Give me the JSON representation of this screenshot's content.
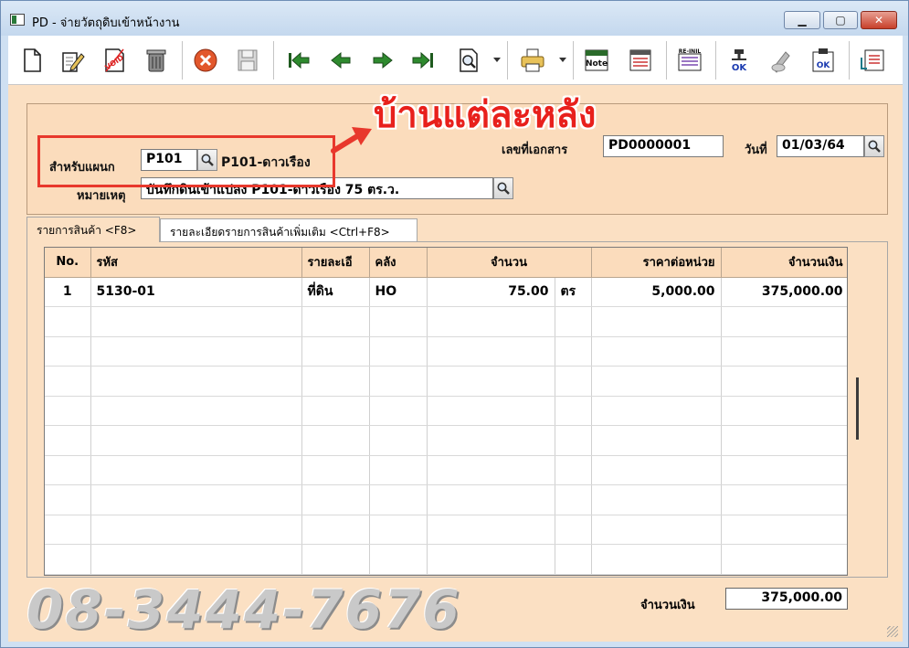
{
  "window": {
    "title": "PD - จ่ายวัตถุดิบเข้าหน้างาน",
    "min_glyph": "▁",
    "max_glyph": "▢",
    "close_glyph": "✕"
  },
  "toolbar": {
    "items": [
      "new-document-icon",
      "edit-icon",
      "void-icon",
      "delete-icon",
      "cancel-icon",
      "save-icon",
      "first-record-icon",
      "previous-record-icon",
      "next-record-icon",
      "last-record-icon",
      "find-icon",
      "print-icon",
      "note-icon",
      "form-icon",
      "recalc-icon",
      "approve-icon",
      "unapprove-icon",
      "document-approve-icon",
      "attach-icon"
    ],
    "void_label": "VOID",
    "note_label": "Note",
    "recalc_label": "RE-INIL",
    "ok_label": "OK"
  },
  "annotation": {
    "title": "บ้านแต่ละหลัง",
    "color": "#e8201c"
  },
  "header": {
    "department_label": "สำหรับแผนก",
    "department_code": "P101",
    "department_name": "P101-ดาวเรือง",
    "remark_label": "หมายเหตุ",
    "remark_value": "บันทึกดินเข้าแปลง P101-ดาวเรือง 75 ตร.ว.",
    "doc_no_label": "เลขที่เอกสาร",
    "doc_no_value": "PD0000001",
    "date_label": "วันที่",
    "date_value": "01/03/64"
  },
  "tabs": [
    {
      "label": "รายการสินค้า <F8>"
    },
    {
      "label": "รายละเอียดรายการสินค้าเพิ่มเติม  <Ctrl+F8>"
    }
  ],
  "grid": {
    "columns": [
      "No.",
      "รหัส",
      "รายละเอี",
      "คลัง",
      "จำนวน",
      "ราคาต่อหน่วย",
      "จำนวนเงิน"
    ],
    "rows": [
      {
        "no": "1",
        "code": "5130-01",
        "desc": "ที่ดิน",
        "warehouse": "HO",
        "qty": "75.00",
        "unit": "ตร",
        "price": "5,000.00",
        "amount": "375,000.00"
      }
    ]
  },
  "footer": {
    "total_label": "จำนวนเงิน",
    "total_value": "375,000.00",
    "phone": "08-3444-7676"
  }
}
